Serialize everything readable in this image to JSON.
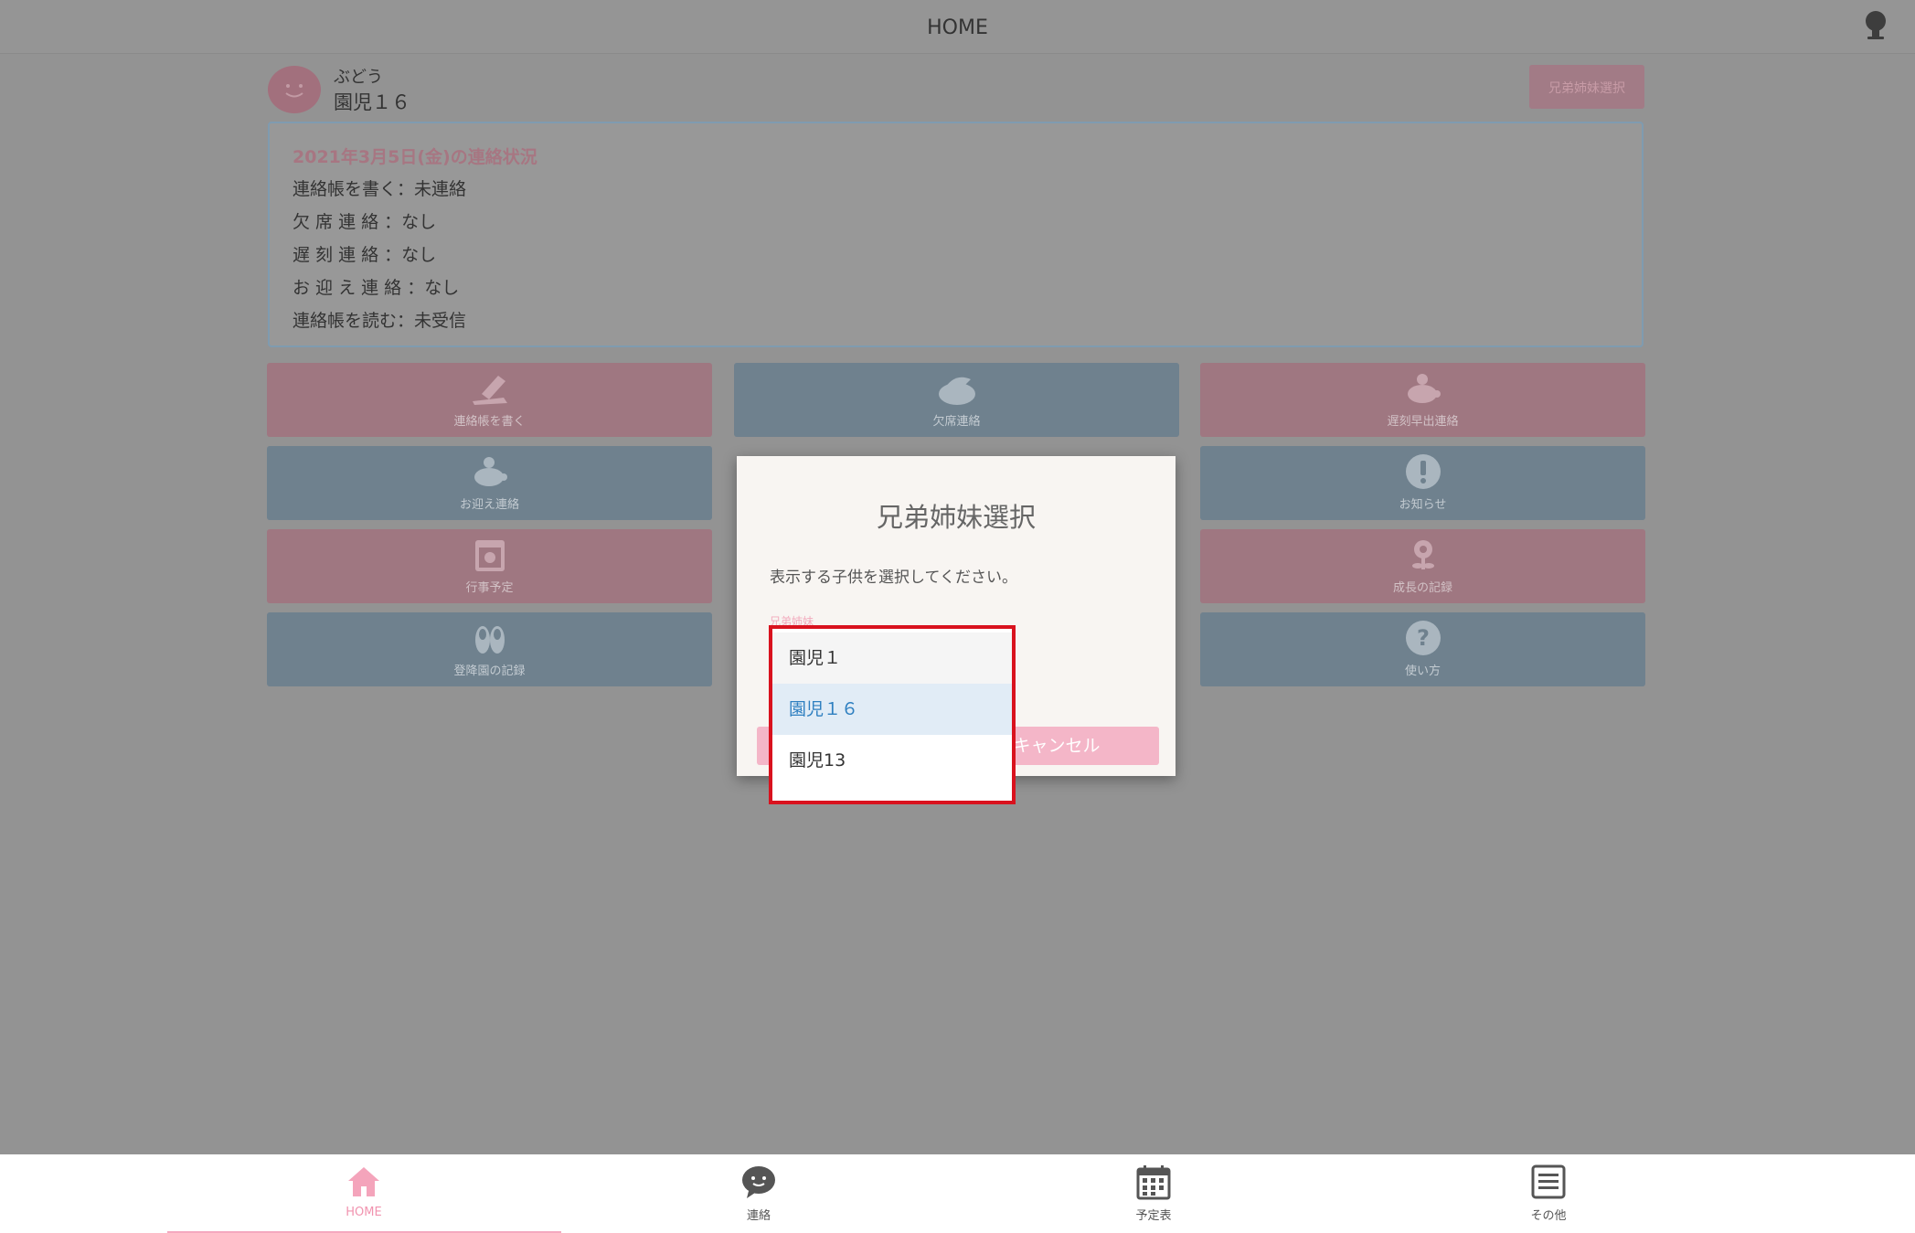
{
  "header": {
    "title": "HOME",
    "user_icon": "user-avatar-icon"
  },
  "profile": {
    "group": "ぶどう",
    "name": "園児１６",
    "icon": "smiley-face-icon"
  },
  "sibling_button": {
    "label": "兄弟姉妹選択"
  },
  "status": {
    "date_title": "2021年3月5日(金)の連絡状況",
    "lines": [
      "連絡帳を書く：未連絡",
      "欠 席 連 絡 ：なし",
      "遅 刻 連 絡 ：なし",
      "お 迎 え 連 絡 ：なし",
      "連絡帳を読む：未受信"
    ]
  },
  "tiles": [
    {
      "label": "連絡帳を書く",
      "icon": "pencil-notebook-icon",
      "color": "pink"
    },
    {
      "label": "欠席連絡",
      "icon": "sleeping-cap-icon",
      "color": "blue"
    },
    {
      "label": "遅刻早出連絡",
      "icon": "turtle-icon",
      "color": "pink"
    },
    {
      "label": "お迎え連絡",
      "icon": "turtle-carrying-icon",
      "color": "blue"
    },
    {
      "label": "お知らせ",
      "icon": "exclamation-icon",
      "color": "blue"
    },
    {
      "label": "行事予定",
      "icon": "calendar-icon",
      "color": "pink"
    },
    {
      "label": "成長の記録",
      "icon": "flower-icon",
      "color": "pink"
    },
    {
      "label": "登降園の記録",
      "icon": "shoes-icon",
      "color": "blue"
    },
    {
      "label": "使い方",
      "icon": "question-icon",
      "color": "blue"
    }
  ],
  "modal": {
    "title": "兄弟姉妹選択",
    "message": "表示する子供を選択してください。",
    "field_label": "兄弟姉妹",
    "cancel_label": "キャンセル"
  },
  "dropdown": {
    "options": [
      "園児１",
      "園児１６",
      "園児13"
    ],
    "selected": "園児１６"
  },
  "bottom_nav": [
    {
      "label": "HOME",
      "icon": "home-icon",
      "active": true
    },
    {
      "label": "連絡",
      "icon": "chat-bubble-icon",
      "active": false
    },
    {
      "label": "予定表",
      "icon": "calendar-grid-icon",
      "active": false
    },
    {
      "label": "その他",
      "icon": "menu-list-icon",
      "active": false
    }
  ],
  "colors": {
    "accent_pink": "#f4b6c8",
    "selected_blue": "#2e7fc0",
    "highlight_red": "#d9121e"
  }
}
